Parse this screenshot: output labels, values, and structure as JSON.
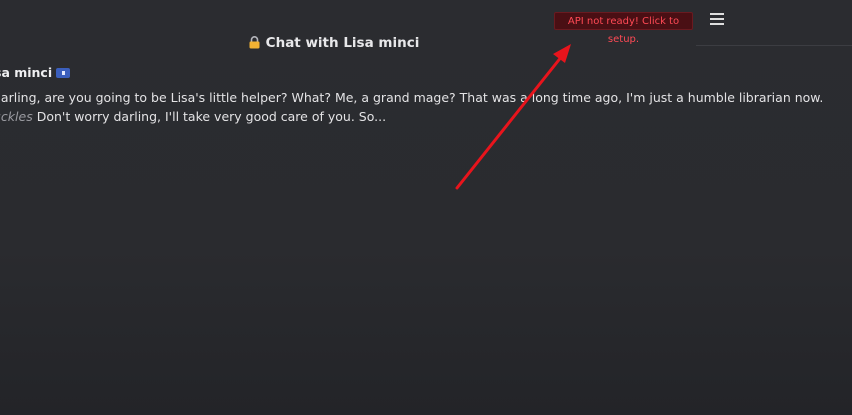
{
  "header": {
    "title": "Chat with Lisa minci",
    "lock_icon": "lock-icon"
  },
  "api_warning": {
    "label": "API not ready! Click to setup.",
    "color": "#ff4a55"
  },
  "menu": {
    "icon": "hamburger-menu-icon"
  },
  "message": {
    "speaker": "sa minci",
    "line1": " darling, are you going to be Lisa's little helper? What? Me, a grand mage? That was a long time ago, I'm just a humble librarian now.",
    "line2_italic": "uckles",
    "line2_text": " Don't worry darling, I'll take very good care of you. So..."
  },
  "annotation": {
    "arrow_color": "#e8141c"
  }
}
